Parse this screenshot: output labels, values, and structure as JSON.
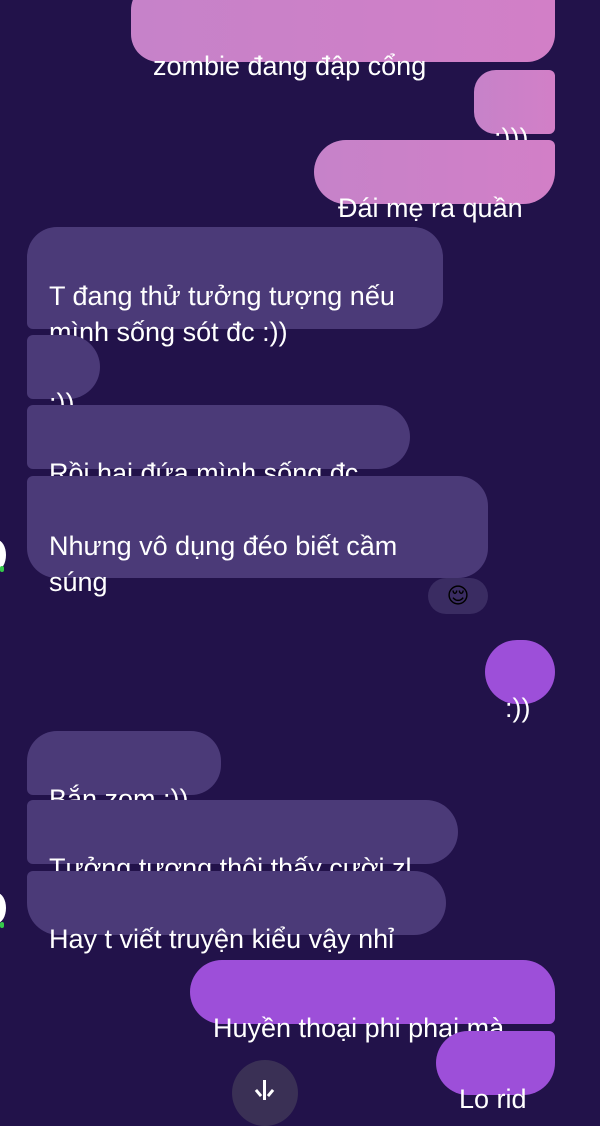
{
  "messages": [
    {
      "direction": "outgoing",
      "text": "zombie đang đập cổng"
    },
    {
      "direction": "outgoing",
      "text": ":)))"
    },
    {
      "direction": "outgoing",
      "text": "Đái mẹ ra quần"
    },
    {
      "direction": "incoming",
      "text": "T đang thử tưởng tượng nếu\nmình sống sót đc :))"
    },
    {
      "direction": "incoming",
      "text": ":))"
    },
    {
      "direction": "incoming",
      "text": "Rồi hai đứa mình sống đc"
    },
    {
      "direction": "incoming",
      "text": "Nhưng vô dụng đéo biết cầm\nsúng",
      "reaction": "😌"
    },
    {
      "direction": "outgoing",
      "text": ":))"
    },
    {
      "direction": "incoming",
      "text": "Bắn zom :))"
    },
    {
      "direction": "incoming",
      "text": "Tưởng tượng thôi thấy cười zl"
    },
    {
      "direction": "incoming",
      "text": "Hay t viết truyện kiểu vậy nhỉ"
    },
    {
      "direction": "outgoing",
      "text": "Huyền thoại phi phai mà"
    },
    {
      "direction": "outgoing",
      "text": "Lo rid"
    }
  ],
  "colors": {
    "background": "#22124a",
    "incoming_bubble": "#4b3a78",
    "outgoing_pink": "#cf80c8",
    "outgoing_purple": "#9d4fd9",
    "online_status": "#35c94a"
  },
  "icons": {
    "reaction": "smiling-face-emoji",
    "scroll": "arrow-down-icon"
  }
}
